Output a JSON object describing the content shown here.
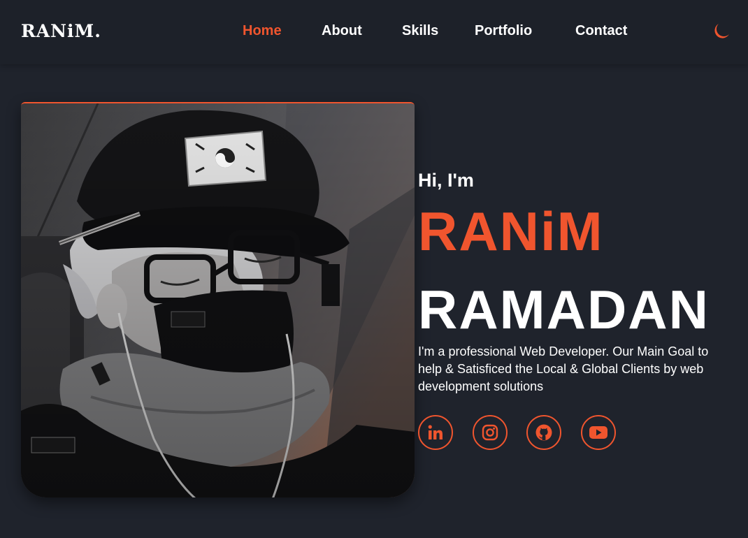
{
  "brand": {
    "logo_text": "RANiM."
  },
  "nav": {
    "items": [
      {
        "label": "Home",
        "active": true
      },
      {
        "label": "About",
        "active": false
      },
      {
        "label": "Skills",
        "active": false
      },
      {
        "label": "Portfolio",
        "active": false
      },
      {
        "label": "Contact",
        "active": false
      }
    ],
    "theme_toggle_icon": "moon-icon"
  },
  "hero": {
    "greeting": "Hi, I'm",
    "first_name": "RANiM",
    "last_name": "RAMADAN",
    "description": "I'm a professional Web Developer. Our Main Goal to help & Satisficed the Local & Global Clients by web development solutions",
    "profile_image": "anime-style avatar with cap, glasses and mask",
    "socials": [
      {
        "name": "linkedin",
        "icon": "linkedin-icon"
      },
      {
        "name": "instagram",
        "icon": "instagram-icon"
      },
      {
        "name": "github",
        "icon": "github-icon"
      },
      {
        "name": "youtube",
        "icon": "youtube-icon"
      }
    ]
  },
  "colors": {
    "accent": "#f0552e",
    "background": "#1f232c",
    "navbar": "#1d2129",
    "text": "#ffffff"
  }
}
